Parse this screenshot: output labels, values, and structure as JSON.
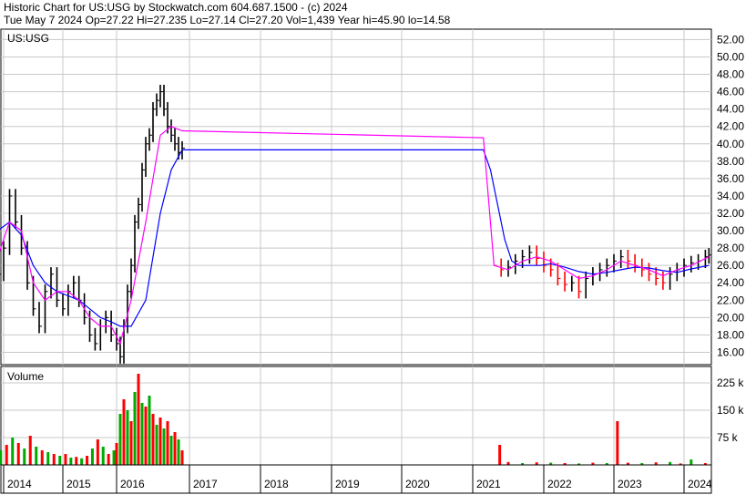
{
  "header": {
    "line1": "Historic Chart for US:USG by Stockwatch.com 604.687.1500 - (c) 2024",
    "line2": "Tue May  7 2024  Op=27.22  Hi=27.235  Lo=27.14  Cl=27.20  Vol=1,439  Year hi=45.90  lo=14.58"
  },
  "colors": {
    "price_bars": "#000000",
    "ma_short": "#ff00ff",
    "ma_long": "#0000ff",
    "down_ticks": "#ff0000",
    "volume_up": "#00aa00",
    "volume_down": "#ff0000",
    "grid": "#c8c8c8",
    "background": "#ffffff"
  },
  "chart_data": [
    {
      "type": "line",
      "title": "US:USG",
      "xlabel": "",
      "ylabel": "",
      "grid": true,
      "ylim": [
        14.58,
        53.2
      ],
      "y_ticks": [
        "52.00",
        "50.00",
        "48.00",
        "46.00",
        "44.00",
        "42.00",
        "40.00",
        "38.00",
        "36.00",
        "34.00",
        "32.00",
        "30.00",
        "28.00",
        "26.00",
        "24.00",
        "22.00",
        "20.00",
        "18.00",
        "16.00"
      ],
      "x_ticks": [
        "2014",
        "2015",
        "2016",
        "2017",
        "2018",
        "2019",
        "2020",
        "2021",
        "2022",
        "2023",
        "2024"
      ],
      "series": [
        {
          "kind": "price",
          "x": [
            2013.9,
            2014.0,
            2014.1,
            2014.2,
            2014.3,
            2014.4,
            2014.5,
            2014.6,
            2014.7,
            2014.8,
            2014.9,
            2015.0,
            2015.1,
            2015.2,
            2015.3,
            2015.4,
            2015.5,
            2015.6,
            2015.7,
            2015.8,
            2015.9,
            2016.0,
            2016.05,
            2016.1,
            2016.15,
            2016.2,
            2016.25,
            2016.3,
            2016.35,
            2016.4,
            2016.45,
            2016.5,
            2016.55,
            2016.6,
            2016.65,
            2016.7,
            2016.75,
            2016.8,
            2016.85,
            2016.9,
            2021.3,
            2021.4,
            2021.5,
            2021.6,
            2021.7,
            2021.8,
            2021.9,
            2022.0,
            2022.1,
            2022.2,
            2022.3,
            2022.4,
            2022.5,
            2022.6,
            2022.7,
            2022.8,
            2022.9,
            2023.0,
            2023.1,
            2023.2,
            2023.3,
            2023.4,
            2023.5,
            2023.6,
            2023.7,
            2023.8,
            2023.9,
            2024.0,
            2024.1,
            2024.2,
            2024.3,
            2024.35
          ],
          "y": [
            25,
            28,
            34,
            31,
            28,
            24,
            21,
            19,
            23,
            25,
            22,
            21,
            23,
            24,
            22,
            20,
            18,
            17,
            19,
            20,
            18,
            17,
            15.5,
            19,
            23,
            26,
            31,
            33,
            37,
            40,
            41,
            44,
            45,
            46,
            44,
            42,
            41,
            40,
            39,
            39.5,
            26,
            25.5,
            25.8,
            26.5,
            27,
            27.5,
            26.8,
            26,
            25.5,
            24.5,
            23.8,
            24,
            23,
            24.5,
            25,
            25.5,
            26,
            26.5,
            27,
            26.5,
            26,
            25.5,
            25,
            24.5,
            24,
            25,
            25.5,
            26,
            26.3,
            26.5,
            27,
            27.2
          ]
        },
        {
          "kind": "moving_average_short",
          "x": [
            2013.9,
            2014.1,
            2014.3,
            2014.5,
            2014.7,
            2014.9,
            2015.1,
            2015.3,
            2015.5,
            2015.7,
            2015.9,
            2016.05,
            2016.2,
            2016.4,
            2016.6,
            2016.75,
            2016.9,
            2021.15,
            2021.3,
            2021.5,
            2021.7,
            2021.9,
            2022.1,
            2022.3,
            2022.5,
            2022.7,
            2022.9,
            2023.1,
            2023.3,
            2023.5,
            2023.7,
            2023.9,
            2024.1,
            2024.35
          ],
          "y": [
            27,
            31,
            30,
            24,
            22,
            23,
            23,
            22,
            20,
            19,
            19,
            17,
            22,
            31,
            41,
            42,
            41.5,
            40.7,
            26,
            25.5,
            26.5,
            27,
            26.5,
            25.5,
            24.5,
            24.8,
            25.5,
            26.5,
            26,
            25.5,
            24.8,
            25.5,
            26,
            27
          ]
        },
        {
          "kind": "moving_average_long",
          "x": [
            2013.9,
            2014.1,
            2014.3,
            2014.5,
            2014.7,
            2014.9,
            2015.1,
            2015.3,
            2015.5,
            2015.7,
            2015.9,
            2016.05,
            2016.2,
            2016.4,
            2016.6,
            2016.75,
            2016.9,
            2021.15,
            2021.25,
            2021.35,
            2021.45,
            2021.55,
            2021.65,
            2021.75,
            2021.85,
            2021.95,
            2022.1,
            2022.3,
            2022.5,
            2022.7,
            2022.9,
            2023.1,
            2023.3,
            2023.5,
            2023.7,
            2023.9,
            2024.1,
            2024.35
          ],
          "y": [
            30,
            31,
            29.5,
            26,
            24,
            23,
            22.5,
            22,
            21,
            20,
            19.5,
            19,
            19,
            22,
            32,
            37,
            39.3,
            39.3,
            37,
            33,
            29,
            26.5,
            26,
            26,
            26,
            26,
            26.2,
            25.8,
            25.3,
            25,
            25.2,
            25.5,
            25.8,
            25.7,
            25.4,
            25.2,
            25.6,
            26
          ]
        }
      ]
    },
    {
      "type": "bar",
      "title": "Volume",
      "xlabel": "",
      "ylabel": "",
      "grid": true,
      "ylim": [
        0,
        270000
      ],
      "y_ticks": [
        "225 k",
        "150 k",
        "75 k"
      ],
      "series": [
        {
          "name": "",
          "x": [
            2013.95,
            2014.05,
            2014.15,
            2014.25,
            2014.35,
            2014.45,
            2014.55,
            2014.65,
            2014.75,
            2014.85,
            2014.95,
            2015.05,
            2015.15,
            2015.25,
            2015.35,
            2015.45,
            2015.55,
            2015.65,
            2015.75,
            2015.85,
            2015.95,
            2016.0,
            2016.05,
            2016.1,
            2016.15,
            2016.2,
            2016.25,
            2016.3,
            2016.35,
            2016.4,
            2016.45,
            2016.5,
            2016.55,
            2016.6,
            2016.65,
            2016.7,
            2016.75,
            2016.8,
            2016.85,
            2016.9,
            2021.38,
            2021.5,
            2021.7,
            2021.9,
            2022.1,
            2022.3,
            2022.5,
            2022.7,
            2022.9,
            2023.05,
            2023.2,
            2023.4,
            2023.6,
            2023.8,
            2023.95,
            2024.1,
            2024.3
          ],
          "values": [
            40000,
            55000,
            75000,
            60000,
            45000,
            80000,
            50000,
            40000,
            35000,
            30000,
            25000,
            30000,
            20000,
            22000,
            18000,
            25000,
            45000,
            70000,
            50000,
            30000,
            40000,
            60000,
            140000,
            180000,
            150000,
            120000,
            200000,
            250000,
            170000,
            160000,
            190000,
            140000,
            110000,
            130000,
            100000,
            120000,
            80000,
            90000,
            70000,
            40000,
            55000,
            8000,
            5000,
            7000,
            6000,
            5000,
            4000,
            6000,
            5000,
            120000,
            6000,
            5000,
            7000,
            8000,
            4000,
            15000,
            5000
          ],
          "direction": [
            "up",
            "down",
            "up",
            "down",
            "up",
            "down",
            "up",
            "down",
            "up",
            "down",
            "up",
            "down",
            "up",
            "down",
            "up",
            "down",
            "up",
            "down",
            "up",
            "down",
            "up",
            "down",
            "up",
            "down",
            "up",
            "down",
            "up",
            "down",
            "up",
            "down",
            "up",
            "down",
            "up",
            "down",
            "up",
            "down",
            "up",
            "down",
            "up",
            "down",
            "down",
            "down",
            "up",
            "down",
            "up",
            "down",
            "up",
            "down",
            "up",
            "down",
            "down",
            "up",
            "down",
            "up",
            "down",
            "up",
            "down"
          ]
        }
      ]
    }
  ]
}
